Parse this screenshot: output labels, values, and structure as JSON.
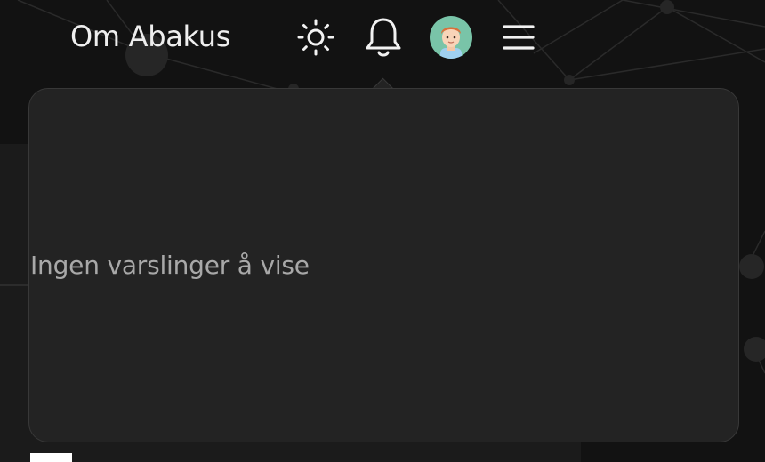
{
  "header": {
    "nav_link": "Om Abakus",
    "icons": {
      "theme": "sun-icon",
      "notifications": "bell-icon",
      "avatar": "avatar",
      "menu": "hamburger-menu-icon"
    }
  },
  "notifications_dropdown": {
    "empty_message": "Ingen varslinger å vise"
  },
  "colors": {
    "background": "#121212",
    "dropdown_background": "#232323",
    "dropdown_border": "#383838",
    "text": "#eeeeee",
    "muted_text": "#a8a8a8",
    "avatar_bg": "#79c4a8"
  }
}
